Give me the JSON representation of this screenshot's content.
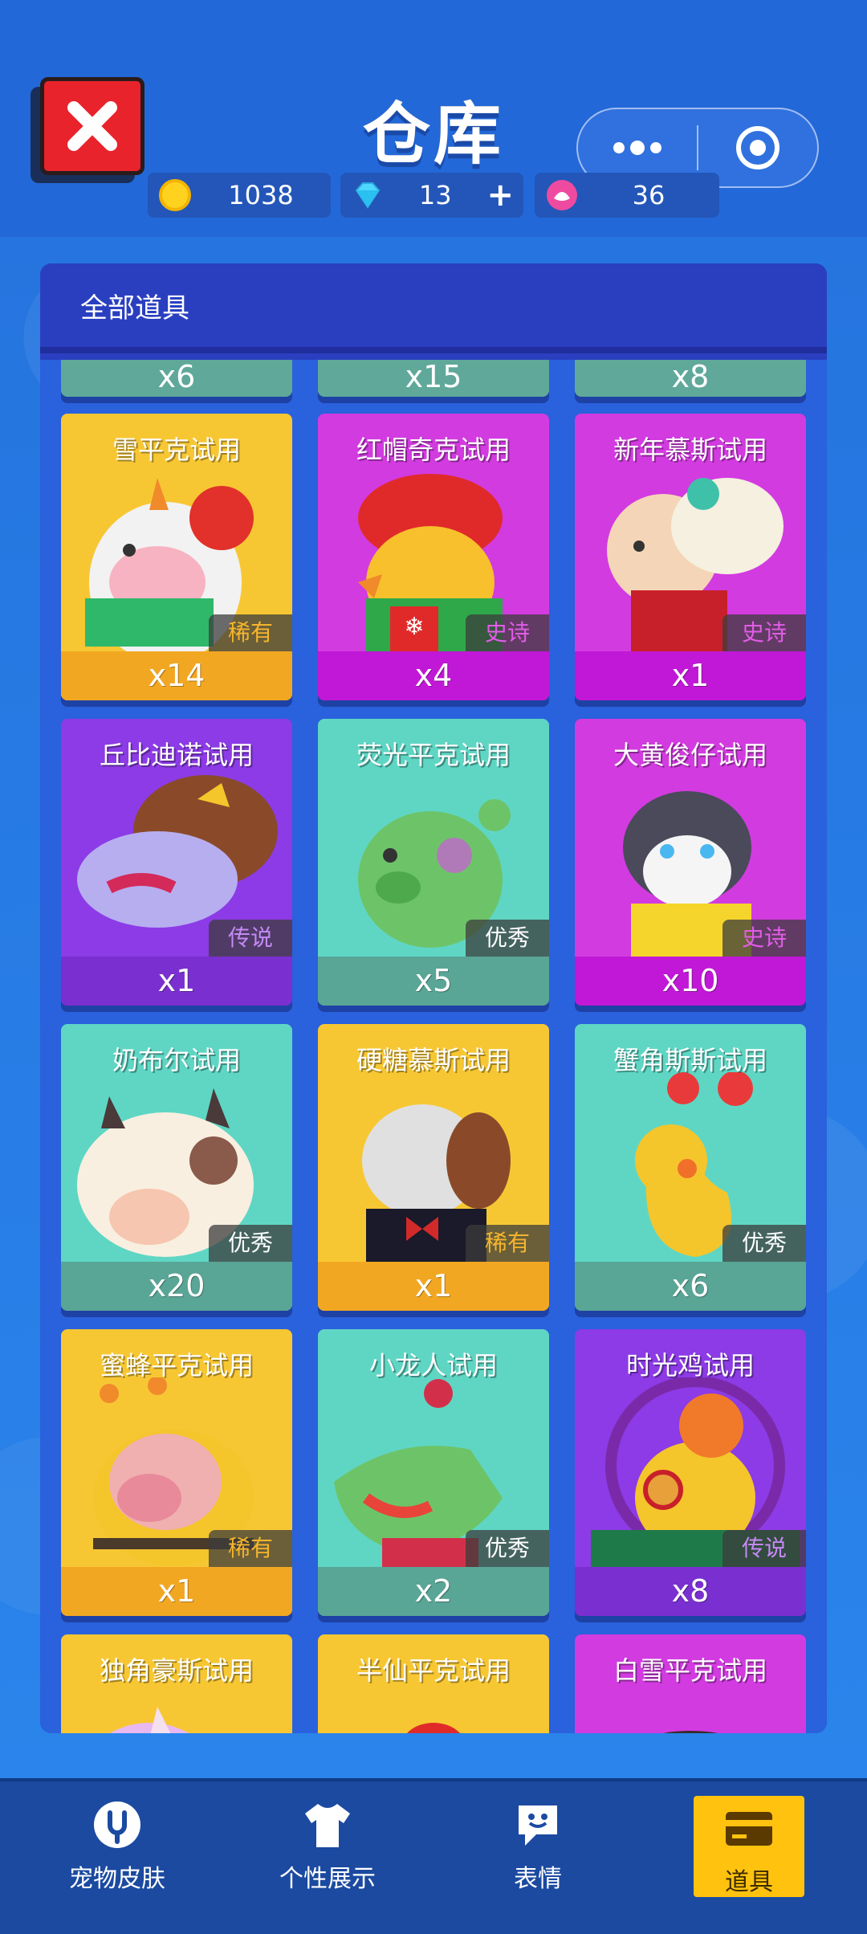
{
  "header": {
    "title": "仓库",
    "coins": "1038",
    "diamonds": "13",
    "diamonds_plus": "+",
    "tokens": "36"
  },
  "panel": {
    "title": "全部道具"
  },
  "top_stubs": [
    {
      "count": "x6"
    },
    {
      "count": "x15"
    },
    {
      "count": "x8"
    }
  ],
  "items": [
    {
      "title": "雪平克试用",
      "rarity": "稀有",
      "count": "x14"
    },
    {
      "title": "红帽奇克试用",
      "rarity": "史诗",
      "count": "x4"
    },
    {
      "title": "新年慕斯试用",
      "rarity": "史诗",
      "count": "x1"
    },
    {
      "title": "丘比迪诺试用",
      "rarity": "传说",
      "count": "x1"
    },
    {
      "title": "荧光平克试用",
      "rarity": "优秀",
      "count": "x5"
    },
    {
      "title": "大黄俊仔试用",
      "rarity": "史诗",
      "count": "x10"
    },
    {
      "title": "奶布尔试用",
      "rarity": "优秀",
      "count": "x20"
    },
    {
      "title": "硬糖慕斯试用",
      "rarity": "稀有",
      "count": "x1"
    },
    {
      "title": "蟹角斯斯试用",
      "rarity": "优秀",
      "count": "x6"
    },
    {
      "title": "蜜蜂平克试用",
      "rarity": "稀有",
      "count": "x1"
    },
    {
      "title": "小龙人试用",
      "rarity": "优秀",
      "count": "x2"
    },
    {
      "title": "时光鸡试用",
      "rarity": "传说",
      "count": "x8"
    },
    {
      "title": "独角豪斯试用"
    },
    {
      "title": "半仙平克试用"
    },
    {
      "title": "白雪平克试用"
    }
  ],
  "nav": {
    "skins": "宠物皮肤",
    "showcase": "个性展示",
    "emotes": "表情",
    "items": "道具"
  },
  "colors": {
    "rare": "#f5b52c",
    "epic": "#d23be0",
    "legend": "#8a3be0",
    "good": "#5fd6c4",
    "nav_active": "#ffc20e"
  }
}
